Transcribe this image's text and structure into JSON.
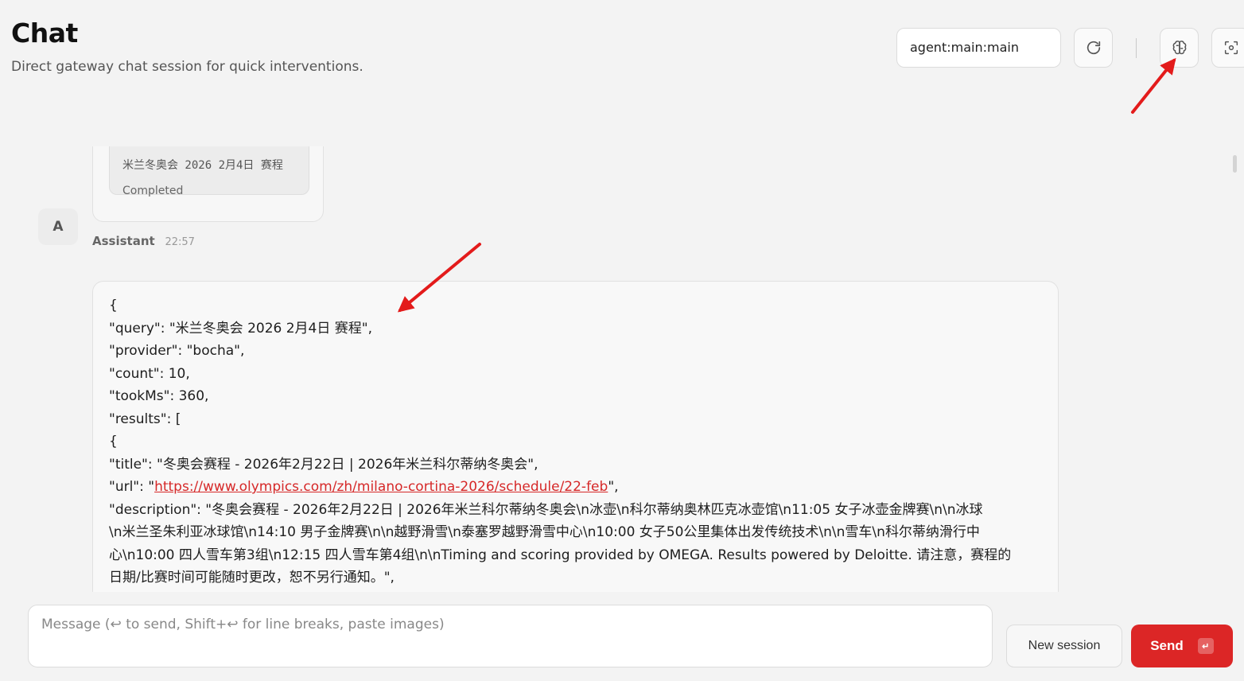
{
  "header": {
    "title": "Chat",
    "subtitle": "Direct gateway chat session for quick interventions.",
    "session_key": "agent:main:main",
    "icons": [
      "refresh-icon",
      "brain-icon",
      "focus-icon"
    ]
  },
  "chat": {
    "tool_card": {
      "query": "米兰冬奥会 2026 2月4日 赛程",
      "status": "Completed"
    },
    "assistant": {
      "avatar": "A",
      "name": "Assistant",
      "time": "22:57"
    },
    "message_lines": [
      "{",
      "\"query\": \"米兰冬奥会 2026 2月4日 赛程\",",
      "\"provider\": \"bocha\",",
      "\"count\": 10,",
      "\"tookMs\": 360,",
      "\"results\": [",
      "{",
      "\"title\": \"冬奥会赛程 - 2026年2月22日 | 2026年米兰科尔蒂纳冬奥会\","
    ],
    "url_line": {
      "prefix": "\"url\": \"",
      "link": "https://www.olympics.com/zh/milano-cortina-2026/schedule/22-feb",
      "suffix": "\","
    },
    "description_lines": [
      "\"description\": \"冬奥会赛程 - 2026年2月22日 | 2026年米兰科尔蒂纳冬奥会\\n冰壶\\n科尔蒂纳奥林匹克冰壶馆\\n11:05 女子冰壶金牌赛\\n\\n冰球",
      "\\n米兰圣朱利亚冰球馆\\n14:10 男子金牌赛\\n\\n越野滑雪\\n泰塞罗越野滑雪中心\\n10:00 女子50公里集体出发传统技术\\n\\n雪车\\n科尔蒂纳滑行中",
      "心\\n10:00 四人雪车第3组\\n12:15 四人雪车第4组\\n\\nTiming and scoring provided by OMEGA. Results powered by Deloitte. 请注意，赛程的",
      "日期/比赛时间可能随时更改，恕不另行通知。\","
    ]
  },
  "composer": {
    "placeholder": "Message (↩ to send, Shift+↩ for line breaks, paste images)",
    "new_session_label": "New session",
    "send_label": "Send",
    "send_shortcut": "↵"
  },
  "colors": {
    "accent": "#dc2626",
    "annotation": "#e31b1b"
  }
}
